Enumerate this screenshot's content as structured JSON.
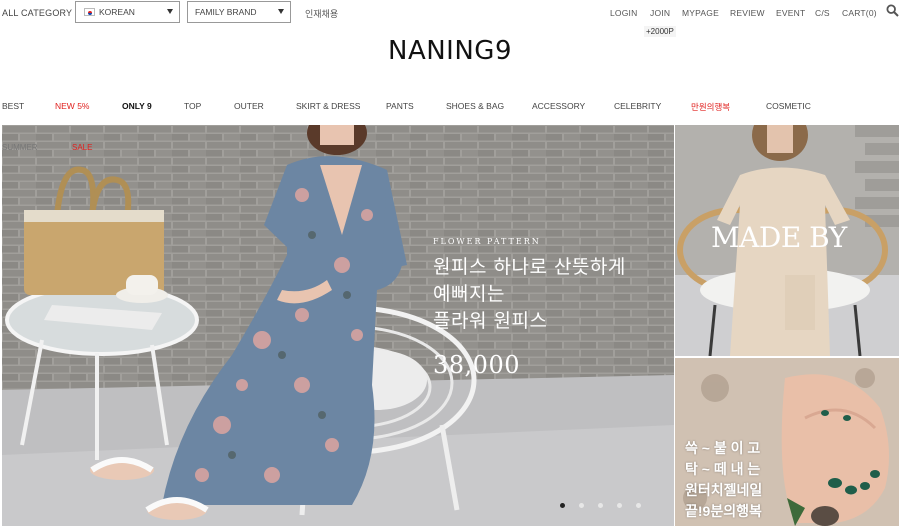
{
  "topbar": {
    "all_category": "ALL CATEGORY",
    "language_select": {
      "value": "KOREAN",
      "flag_icon": "korea-flag-icon"
    },
    "brand_select": {
      "value": "FAMILY BRAND"
    },
    "recruit_link": "인재채용",
    "util_links": [
      "LOGIN",
      "JOIN",
      "MYPAGE",
      "REVIEW",
      "EVENT",
      "C/S",
      "CART(0)"
    ],
    "join_badge": "+2000P",
    "search_icon": "search-icon"
  },
  "logo": "NANING9",
  "nav": {
    "items": [
      "BEST",
      "NEW 5%",
      "ONLY 9",
      "TOP",
      "OUTER",
      "SKIRT & DRESS",
      "PANTS",
      "SHOES & BAG",
      "ACCESSORY",
      "CELEBRITY",
      "만원의행복",
      "COSMETIC"
    ],
    "accent_color": "#e0201e"
  },
  "hero": {
    "tabs": [
      "SUMMER",
      "SALE"
    ],
    "eyebrow": "FLOWER PATTERN",
    "lines": [
      "원피스 하나로 산뜻하게",
      "예뻐지는",
      "플라워 원피스"
    ],
    "price": "38,000",
    "slide_count": 5,
    "active_slide": 1
  },
  "side_banners": {
    "banner1_text": "MADE BY",
    "banner2_lines": [
      "쓱 ~ 붙 이 고",
      "탁 ~ 떼 내 는",
      "원터치젤네일",
      "끝!9분의행복"
    ]
  }
}
